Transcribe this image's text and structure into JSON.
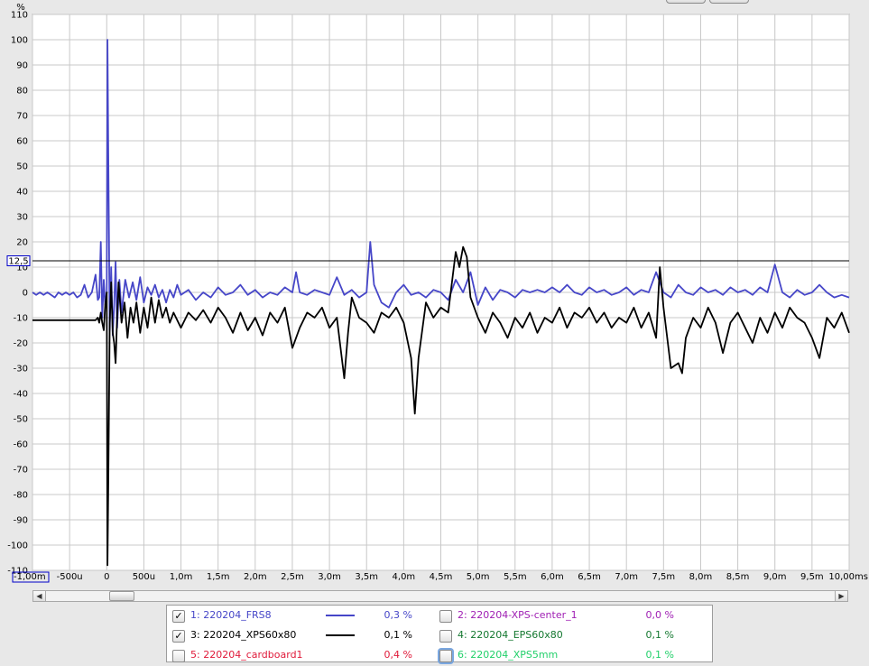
{
  "chart_data": {
    "type": "line",
    "y_unit": "%",
    "y_ticks": [
      "110",
      "100",
      "90",
      "80",
      "70",
      "60",
      "50",
      "40",
      "30",
      "20",
      "10",
      "0",
      "-10",
      "-20",
      "-30",
      "-40",
      "-50",
      "-60",
      "-70",
      "-80",
      "-90",
      "-100",
      "-110"
    ],
    "y_tick_values": [
      110,
      100,
      90,
      80,
      70,
      60,
      50,
      40,
      30,
      20,
      10,
      0,
      -10,
      -20,
      -30,
      -40,
      -50,
      -60,
      -70,
      -80,
      -90,
      -100,
      -110
    ],
    "ylim": [
      -110,
      110
    ],
    "xlim": [
      -1.0,
      10.0
    ],
    "x_unit_note": "ms",
    "x_tick_values": [
      -1.0,
      -0.5,
      0,
      0.5,
      1.0,
      1.5,
      2.0,
      2.5,
      3.0,
      3.5,
      4.0,
      4.5,
      5.0,
      5.5,
      6.0,
      6.5,
      7.0,
      7.5,
      8.0,
      8.5,
      9.0,
      9.5,
      10.0
    ],
    "x_ticks": [
      "-1,00m",
      "-500u",
      "0",
      "500u",
      "1,0m",
      "1,5m",
      "2,0m",
      "2,5m",
      "3,0m",
      "3,5m",
      "4,0m",
      "4,5m",
      "5,0m",
      "5,5m",
      "6,0m",
      "6,5m",
      "7,0m",
      "7,5m",
      "8,0m",
      "8,5m",
      "9,0m",
      "9,5m",
      "10,00ms"
    ],
    "reference_line": {
      "value": 12.5,
      "label": "12,5"
    },
    "grid": true,
    "series": [
      {
        "name": "1: 220204_FRS8",
        "color": "#4646c8",
        "points": [
          [
            -1.0,
            0
          ],
          [
            -0.95,
            -1
          ],
          [
            -0.9,
            0
          ],
          [
            -0.85,
            -1
          ],
          [
            -0.8,
            0
          ],
          [
            -0.75,
            -1
          ],
          [
            -0.7,
            -2
          ],
          [
            -0.65,
            0
          ],
          [
            -0.6,
            -1
          ],
          [
            -0.55,
            0
          ],
          [
            -0.5,
            -1
          ],
          [
            -0.45,
            0
          ],
          [
            -0.4,
            -2
          ],
          [
            -0.35,
            -1
          ],
          [
            -0.3,
            3
          ],
          [
            -0.25,
            -2
          ],
          [
            -0.2,
            0
          ],
          [
            -0.15,
            7
          ],
          [
            -0.12,
            -3
          ],
          [
            -0.1,
            -2
          ],
          [
            -0.08,
            20
          ],
          [
            -0.06,
            -10
          ],
          [
            -0.04,
            5
          ],
          [
            -0.02,
            -5
          ],
          [
            0,
            0
          ],
          [
            0.01,
            100
          ],
          [
            0.02,
            60
          ],
          [
            0.04,
            -15
          ],
          [
            0.06,
            10
          ],
          [
            0.08,
            -17
          ],
          [
            0.1,
            -5
          ],
          [
            0.12,
            12
          ],
          [
            0.14,
            -14
          ],
          [
            0.17,
            5
          ],
          [
            0.2,
            -8
          ],
          [
            0.25,
            5
          ],
          [
            0.3,
            -2
          ],
          [
            0.35,
            4
          ],
          [
            0.4,
            -3
          ],
          [
            0.45,
            6
          ],
          [
            0.5,
            -4
          ],
          [
            0.55,
            2
          ],
          [
            0.6,
            -1
          ],
          [
            0.65,
            3
          ],
          [
            0.7,
            -2
          ],
          [
            0.75,
            1
          ],
          [
            0.8,
            -4
          ],
          [
            0.85,
            1
          ],
          [
            0.9,
            -2
          ],
          [
            0.95,
            3
          ],
          [
            1.0,
            -1
          ],
          [
            1.1,
            1
          ],
          [
            1.2,
            -3
          ],
          [
            1.3,
            0
          ],
          [
            1.4,
            -2
          ],
          [
            1.5,
            2
          ],
          [
            1.6,
            -1
          ],
          [
            1.7,
            0
          ],
          [
            1.8,
            3
          ],
          [
            1.9,
            -1
          ],
          [
            2.0,
            1
          ],
          [
            2.1,
            -2
          ],
          [
            2.2,
            0
          ],
          [
            2.3,
            -1
          ],
          [
            2.4,
            2
          ],
          [
            2.5,
            0
          ],
          [
            2.55,
            8
          ],
          [
            2.6,
            0
          ],
          [
            2.7,
            -1
          ],
          [
            2.8,
            1
          ],
          [
            2.9,
            0
          ],
          [
            3.0,
            -1
          ],
          [
            3.1,
            6
          ],
          [
            3.2,
            -1
          ],
          [
            3.3,
            1
          ],
          [
            3.4,
            -2
          ],
          [
            3.5,
            0
          ],
          [
            3.55,
            20
          ],
          [
            3.6,
            3
          ],
          [
            3.7,
            -4
          ],
          [
            3.8,
            -6
          ],
          [
            3.9,
            0
          ],
          [
            4.0,
            3
          ],
          [
            4.1,
            -1
          ],
          [
            4.2,
            0
          ],
          [
            4.3,
            -2
          ],
          [
            4.4,
            1
          ],
          [
            4.5,
            0
          ],
          [
            4.6,
            -3
          ],
          [
            4.7,
            5
          ],
          [
            4.8,
            0
          ],
          [
            4.9,
            8
          ],
          [
            5.0,
            -5
          ],
          [
            5.1,
            2
          ],
          [
            5.2,
            -3
          ],
          [
            5.3,
            1
          ],
          [
            5.4,
            0
          ],
          [
            5.5,
            -2
          ],
          [
            5.6,
            1
          ],
          [
            5.7,
            0
          ],
          [
            5.8,
            1
          ],
          [
            5.9,
            0
          ],
          [
            6.0,
            2
          ],
          [
            6.1,
            0
          ],
          [
            6.2,
            3
          ],
          [
            6.3,
            0
          ],
          [
            6.4,
            -1
          ],
          [
            6.5,
            2
          ],
          [
            6.6,
            0
          ],
          [
            6.7,
            1
          ],
          [
            6.8,
            -1
          ],
          [
            6.9,
            0
          ],
          [
            7.0,
            2
          ],
          [
            7.1,
            -1
          ],
          [
            7.2,
            1
          ],
          [
            7.3,
            0
          ],
          [
            7.4,
            8
          ],
          [
            7.5,
            0
          ],
          [
            7.6,
            -2
          ],
          [
            7.7,
            3
          ],
          [
            7.8,
            0
          ],
          [
            7.9,
            -1
          ],
          [
            8.0,
            2
          ],
          [
            8.1,
            0
          ],
          [
            8.2,
            1
          ],
          [
            8.3,
            -1
          ],
          [
            8.4,
            2
          ],
          [
            8.5,
            0
          ],
          [
            8.6,
            1
          ],
          [
            8.7,
            -1
          ],
          [
            8.8,
            2
          ],
          [
            8.9,
            0
          ],
          [
            9.0,
            11
          ],
          [
            9.1,
            0
          ],
          [
            9.2,
            -2
          ],
          [
            9.3,
            1
          ],
          [
            9.4,
            -1
          ],
          [
            9.5,
            0
          ],
          [
            9.6,
            3
          ],
          [
            9.7,
            0
          ],
          [
            9.8,
            -2
          ],
          [
            9.9,
            -1
          ],
          [
            10.0,
            -2
          ]
        ]
      },
      {
        "name": "3: 220204_XPS60x80",
        "color": "#000000",
        "points": [
          [
            -1.0,
            -11
          ],
          [
            -0.7,
            -11
          ],
          [
            -0.4,
            -11
          ],
          [
            -0.15,
            -11
          ],
          [
            -0.12,
            -10
          ],
          [
            -0.1,
            -12
          ],
          [
            -0.08,
            -8
          ],
          [
            -0.06,
            -12
          ],
          [
            -0.04,
            -15
          ],
          [
            -0.02,
            -5
          ],
          [
            0,
            0
          ],
          [
            0.01,
            -108
          ],
          [
            0.02,
            -80
          ],
          [
            0.04,
            -12
          ],
          [
            0.06,
            4
          ],
          [
            0.08,
            -16
          ],
          [
            0.1,
            -20
          ],
          [
            0.12,
            -28
          ],
          [
            0.14,
            -10
          ],
          [
            0.16,
            4
          ],
          [
            0.2,
            -12
          ],
          [
            0.24,
            -4
          ],
          [
            0.28,
            -18
          ],
          [
            0.32,
            -6
          ],
          [
            0.36,
            -12
          ],
          [
            0.4,
            -4
          ],
          [
            0.45,
            -16
          ],
          [
            0.5,
            -6
          ],
          [
            0.55,
            -14
          ],
          [
            0.6,
            -2
          ],
          [
            0.65,
            -12
          ],
          [
            0.7,
            -3
          ],
          [
            0.75,
            -10
          ],
          [
            0.8,
            -6
          ],
          [
            0.85,
            -12
          ],
          [
            0.9,
            -8
          ],
          [
            1.0,
            -14
          ],
          [
            1.1,
            -8
          ],
          [
            1.2,
            -11
          ],
          [
            1.3,
            -7
          ],
          [
            1.4,
            -12
          ],
          [
            1.5,
            -6
          ],
          [
            1.6,
            -10
          ],
          [
            1.7,
            -16
          ],
          [
            1.8,
            -8
          ],
          [
            1.9,
            -15
          ],
          [
            2.0,
            -10
          ],
          [
            2.1,
            -17
          ],
          [
            2.2,
            -8
          ],
          [
            2.3,
            -12
          ],
          [
            2.4,
            -6
          ],
          [
            2.5,
            -22
          ],
          [
            2.6,
            -14
          ],
          [
            2.7,
            -8
          ],
          [
            2.8,
            -10
          ],
          [
            2.9,
            -6
          ],
          [
            3.0,
            -14
          ],
          [
            3.1,
            -10
          ],
          [
            3.2,
            -34
          ],
          [
            3.25,
            -16
          ],
          [
            3.3,
            -2
          ],
          [
            3.4,
            -10
          ],
          [
            3.5,
            -12
          ],
          [
            3.6,
            -16
          ],
          [
            3.7,
            -8
          ],
          [
            3.8,
            -10
          ],
          [
            3.9,
            -6
          ],
          [
            4.0,
            -12
          ],
          [
            4.1,
            -26
          ],
          [
            4.15,
            -48
          ],
          [
            4.2,
            -26
          ],
          [
            4.3,
            -4
          ],
          [
            4.4,
            -10
          ],
          [
            4.5,
            -6
          ],
          [
            4.6,
            -8
          ],
          [
            4.7,
            16
          ],
          [
            4.75,
            10
          ],
          [
            4.8,
            18
          ],
          [
            4.85,
            14
          ],
          [
            4.9,
            -2
          ],
          [
            5.0,
            -10
          ],
          [
            5.1,
            -16
          ],
          [
            5.2,
            -8
          ],
          [
            5.3,
            -12
          ],
          [
            5.4,
            -18
          ],
          [
            5.5,
            -10
          ],
          [
            5.6,
            -14
          ],
          [
            5.7,
            -8
          ],
          [
            5.8,
            -16
          ],
          [
            5.9,
            -10
          ],
          [
            6.0,
            -12
          ],
          [
            6.1,
            -6
          ],
          [
            6.2,
            -14
          ],
          [
            6.3,
            -8
          ],
          [
            6.4,
            -10
          ],
          [
            6.5,
            -6
          ],
          [
            6.6,
            -12
          ],
          [
            6.7,
            -8
          ],
          [
            6.8,
            -14
          ],
          [
            6.9,
            -10
          ],
          [
            7.0,
            -12
          ],
          [
            7.1,
            -6
          ],
          [
            7.2,
            -14
          ],
          [
            7.3,
            -8
          ],
          [
            7.4,
            -18
          ],
          [
            7.45,
            10
          ],
          [
            7.5,
            -6
          ],
          [
            7.6,
            -30
          ],
          [
            7.7,
            -28
          ],
          [
            7.75,
            -32
          ],
          [
            7.8,
            -18
          ],
          [
            7.9,
            -10
          ],
          [
            8.0,
            -14
          ],
          [
            8.1,
            -6
          ],
          [
            8.2,
            -12
          ],
          [
            8.3,
            -24
          ],
          [
            8.4,
            -12
          ],
          [
            8.5,
            -8
          ],
          [
            8.6,
            -14
          ],
          [
            8.7,
            -20
          ],
          [
            8.8,
            -10
          ],
          [
            8.9,
            -16
          ],
          [
            9.0,
            -8
          ],
          [
            9.1,
            -14
          ],
          [
            9.2,
            -6
          ],
          [
            9.3,
            -10
          ],
          [
            9.4,
            -12
          ],
          [
            9.5,
            -18
          ],
          [
            9.6,
            -26
          ],
          [
            9.7,
            -10
          ],
          [
            9.8,
            -14
          ],
          [
            9.9,
            -8
          ],
          [
            10.0,
            -16
          ]
        ]
      }
    ]
  },
  "legend": [
    {
      "checked": true,
      "name": "1: 220204_FRS8",
      "color": "#4646c8",
      "value": "0,3 %",
      "show_line": true
    },
    {
      "checked": false,
      "name": "2: 220204-XPS-center_1",
      "color": "#a020b4",
      "value": "0,0 %",
      "show_line": false
    },
    {
      "checked": true,
      "name": "3: 220204_XPS60x80",
      "color": "#000000",
      "value": "0,1 %",
      "show_line": true
    },
    {
      "checked": false,
      "name": "4: 220204_EPS60x80",
      "color": "#147830",
      "value": "0,1 %",
      "show_line": false
    },
    {
      "checked": false,
      "name": "5: 220204_cardboard1",
      "color": "#e01a3a",
      "value": "0,4 %",
      "show_line": false
    },
    {
      "checked": false,
      "name": "6: 220204_XPS5mm",
      "color": "#22d06a",
      "value": "0,1 %",
      "show_line": false
    }
  ],
  "scroll": {
    "left_arrow": "◀",
    "right_arrow": "▶"
  }
}
